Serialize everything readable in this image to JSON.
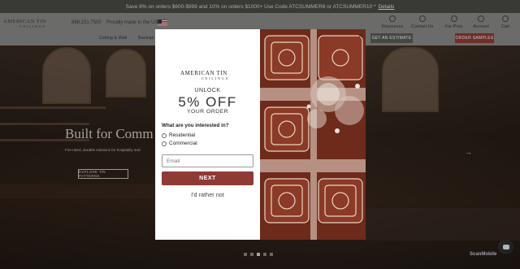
{
  "promo": {
    "text": "Save 8% on orders $600-$999 and 10% on orders $1000+ Use Code ATCSUMMER8 or ATCSUMMER10 *",
    "link": "Details"
  },
  "header": {
    "logo_line1": "AMERICAN TIN",
    "logo_line2": "CEILINGS",
    "phone": "888.231.7500",
    "proudly": "Proudly made in the USA",
    "utilities": [
      {
        "label": "Resources",
        "icon": "globe-icon"
      },
      {
        "label": "Contact Us",
        "icon": "phone-icon"
      },
      {
        "label": "For Pros",
        "icon": "briefcase-icon"
      },
      {
        "label": "Account",
        "icon": "user-icon"
      },
      {
        "label": "Cart",
        "icon": "cart-icon"
      }
    ],
    "nav": [
      "Ceiling & Wall",
      "Backspl"
    ],
    "estimate_button": "GET AN ESTIMATE",
    "samples_button": "ORDER SAMPLES"
  },
  "hero": {
    "title": "Built for Comm",
    "subtitle": "Fire-rated, durable solutions for hospitality and",
    "button": "EXPLORE TIN PATTERNS",
    "arrow": "→",
    "slides": 5,
    "active_slide": 2
  },
  "modal": {
    "logo_line1": "AMERICAN TIN",
    "logo_line2": "CEILINGS",
    "unlock": "UNLOCK",
    "offer": "5% OFF",
    "your_order": "YOUR ORDER",
    "question": "What are you interested in?",
    "options": [
      "Residential",
      "Commercial"
    ],
    "email_placeholder": "Email",
    "next_button": "NEXT",
    "decline": "I'd rather not",
    "close": "×"
  },
  "footer": {
    "brand": "ScanMobile"
  },
  "colors": {
    "accent": "#8e3b35",
    "promo_bg": "#4b4b44",
    "header_bg": "#8a8a87"
  }
}
